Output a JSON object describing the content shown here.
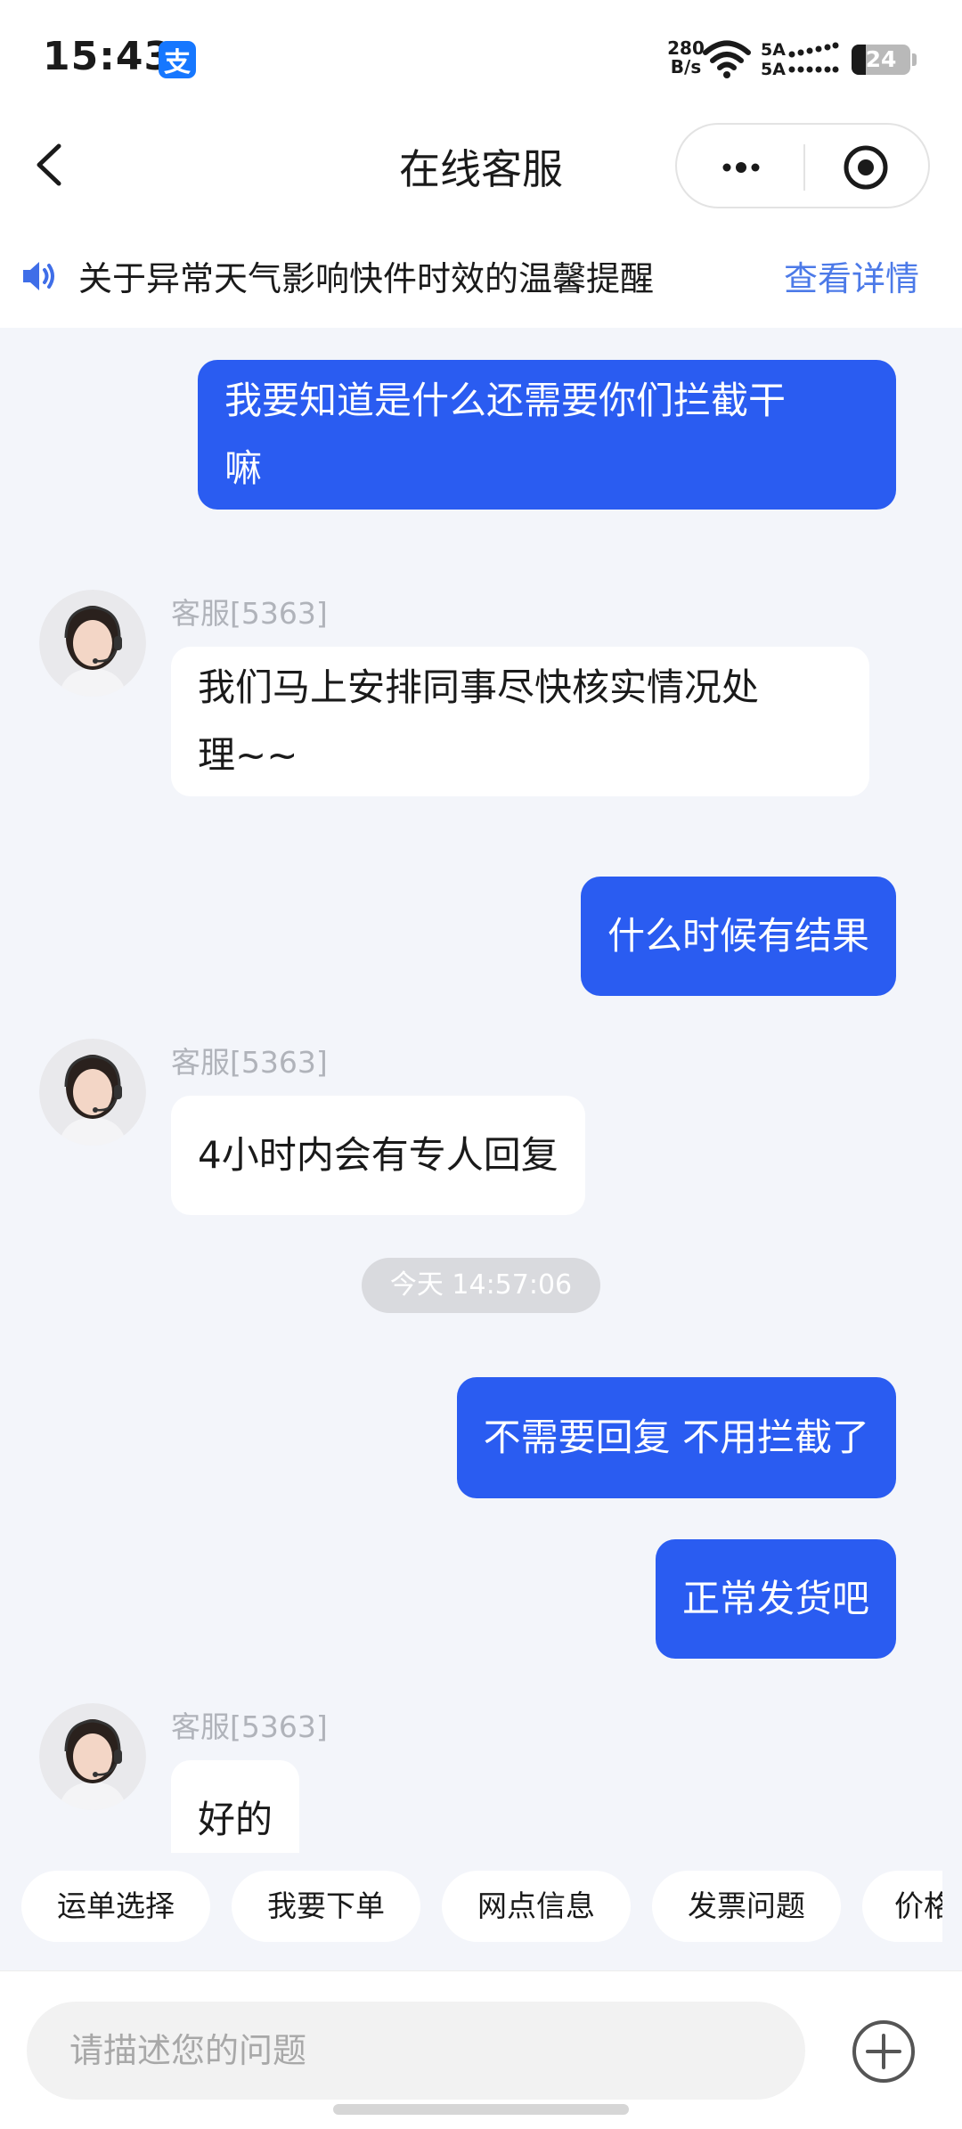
{
  "status_bar": {
    "time": "15:43",
    "app_badge_glyph": "支",
    "net_speed_value": "280",
    "net_speed_unit": "B/s",
    "signal_label_1": "5A",
    "signal_label_2": "5A",
    "battery_level": "24",
    "battery_fraction": 0.24
  },
  "header": {
    "title": "在线客服"
  },
  "notice": {
    "text": "关于异常天气影响快件时效的温馨提醒",
    "link": "查看详情"
  },
  "messages": {
    "m1": {
      "sender": "user",
      "line1": "我要知道是什么还需要你们拦截干",
      "line2": "嘛"
    },
    "m2": {
      "sender": "agent",
      "name": "客服[5363]",
      "line1": "我们马上安排同事尽快核实情况处",
      "line2": "理~~"
    },
    "m3": {
      "sender": "user",
      "text": "什么时候有结果"
    },
    "m4": {
      "sender": "agent",
      "name": "客服[5363]",
      "text": "4小时内会有专人回复"
    },
    "timestamp": "今天 14:57:06",
    "m5": {
      "sender": "user",
      "text": "不需要回复 不用拦截了"
    },
    "m6": {
      "sender": "user",
      "text": "正常发货吧"
    },
    "m7": {
      "sender": "agent",
      "name": "客服[5363]",
      "text": "好的"
    }
  },
  "quick_replies": [
    "运单选择",
    "我要下单",
    "网点信息",
    "发票问题",
    "价格"
  ],
  "input": {
    "placeholder": "请描述您的问题"
  },
  "colors": {
    "user_bubble": "#2a5cf1",
    "link": "#4c7ae8",
    "chat_background": "#f3f5fa"
  }
}
